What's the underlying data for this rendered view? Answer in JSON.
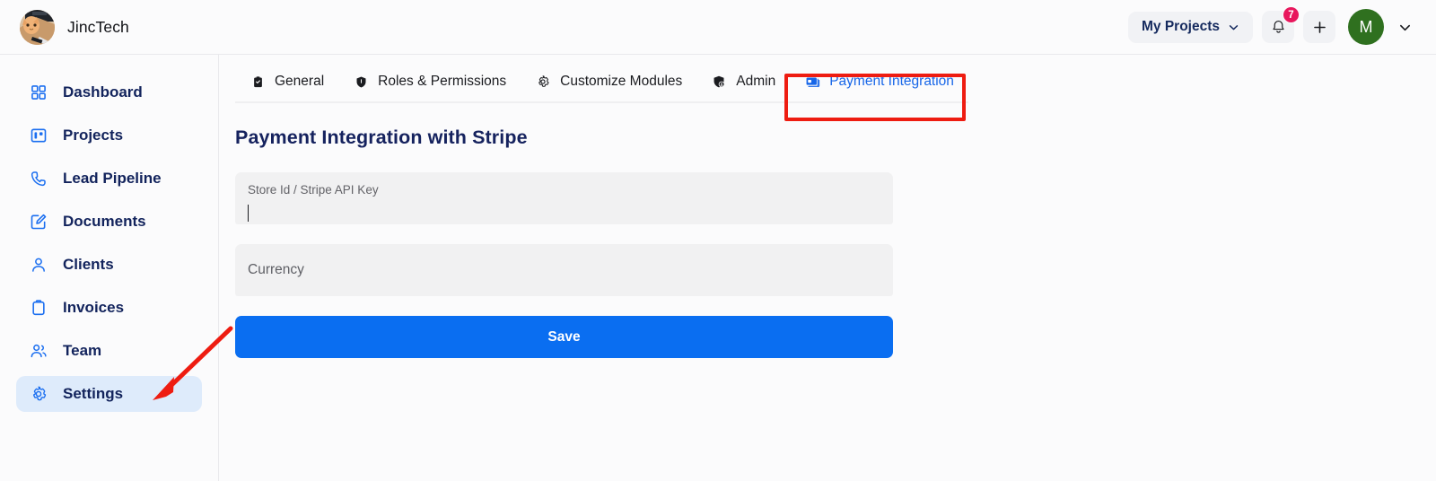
{
  "header": {
    "brand_name": "JincTech",
    "brand_avatar_icon": "cat-photo-avatar",
    "projects_selector_label": "My Projects",
    "projects_selector_icon": "chevron-down-icon",
    "notifications_icon": "bell-icon",
    "notifications_count": "7",
    "add_icon": "plus-icon",
    "user_avatar_initial": "M",
    "user_menu_icon": "chevron-down-icon"
  },
  "sidebar": {
    "items": [
      {
        "label": "Dashboard",
        "icon": "grid-dashboard-icon",
        "active": false
      },
      {
        "label": "Projects",
        "icon": "kanban-board-icon",
        "active": false
      },
      {
        "label": "Lead Pipeline",
        "icon": "phone-icon",
        "active": false
      },
      {
        "label": "Documents",
        "icon": "edit-document-icon",
        "active": false
      },
      {
        "label": "Clients",
        "icon": "user-icon",
        "active": false
      },
      {
        "label": "Invoices",
        "icon": "clipboard-icon",
        "active": false
      },
      {
        "label": "Team",
        "icon": "users-group-icon",
        "active": false
      },
      {
        "label": "Settings",
        "icon": "gear-icon",
        "active": true
      }
    ]
  },
  "main": {
    "tabs": [
      {
        "label": "General",
        "icon": "clipboard-filled-icon",
        "active": false
      },
      {
        "label": "Roles & Permissions",
        "icon": "shield-filled-icon",
        "active": false
      },
      {
        "label": "Customize Modules",
        "icon": "gear-icon",
        "active": false
      },
      {
        "label": "Admin",
        "icon": "admin-badge-icon",
        "active": false
      },
      {
        "label": "Payment Integration",
        "icon": "credit-card-icon",
        "active": true
      }
    ],
    "panel": {
      "title": "Payment Integration with Stripe",
      "api_key_field": {
        "label": "Store Id / Stripe API Key",
        "value": "",
        "focused": true
      },
      "currency_field": {
        "placeholder": "Currency",
        "value": ""
      },
      "save_label": "Save"
    }
  },
  "annotations": {
    "highlight_box_target": "Payment Integration",
    "arrow_target": "Settings",
    "color": "#ee1c11"
  },
  "colors": {
    "accent_blue": "#0a6ef1",
    "nav_text": "#12235c",
    "active_nav_bg": "#deebfb",
    "title_navy": "#15225e",
    "badge_pink": "#e8175d",
    "avatar_green": "#2f701f",
    "field_gray": "#f1f1f2",
    "annotation_red": "#ee1c11"
  }
}
